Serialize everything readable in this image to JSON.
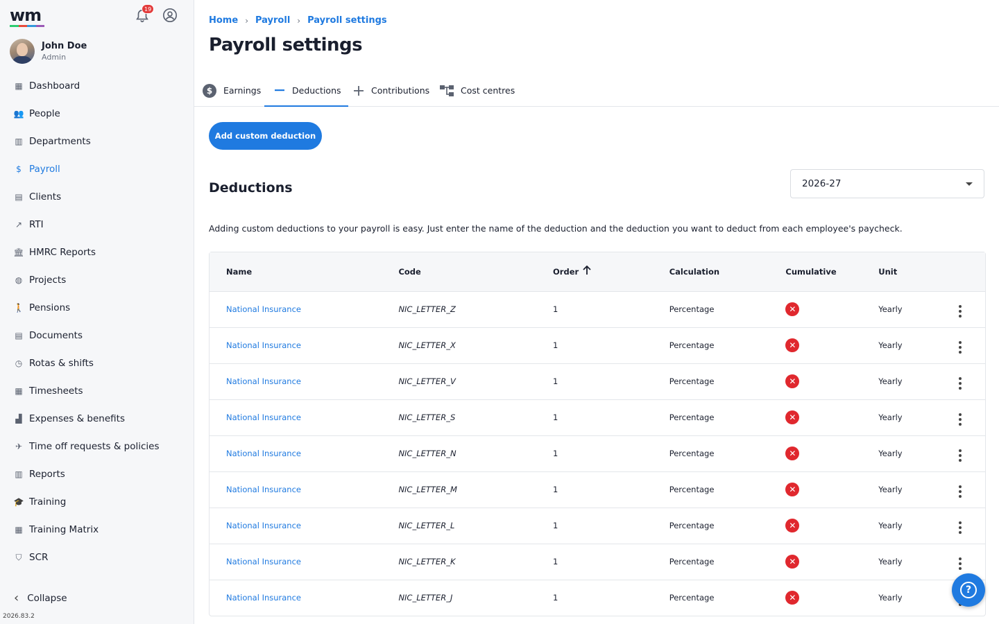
{
  "app": {
    "logo": "wm",
    "logo_colors": [
      "#2ecc71",
      "#e74c3c",
      "#3498db",
      "#9b59b6"
    ],
    "notifications_count": "19",
    "version": "2026.83.2"
  },
  "user": {
    "name": "John Doe",
    "role": "Admin"
  },
  "sidebar": {
    "items": [
      {
        "label": "Dashboard",
        "icon": "dashboard-icon",
        "glyph": "▦"
      },
      {
        "label": "People",
        "icon": "people-icon",
        "glyph": "👥"
      },
      {
        "label": "Departments",
        "icon": "building-icon",
        "glyph": "▥"
      },
      {
        "label": "Payroll",
        "icon": "dollar-icon",
        "glyph": "$"
      },
      {
        "label": "Clients",
        "icon": "clients-icon",
        "glyph": "▤"
      },
      {
        "label": "RTI",
        "icon": "trend-icon",
        "glyph": "↗"
      },
      {
        "label": "HMRC Reports",
        "icon": "bank-icon",
        "glyph": "🏛"
      },
      {
        "label": "Projects",
        "icon": "projects-icon",
        "glyph": "◍"
      },
      {
        "label": "Pensions",
        "icon": "pension-icon",
        "glyph": "🚶"
      },
      {
        "label": "Documents",
        "icon": "document-icon",
        "glyph": "▤"
      },
      {
        "label": "Rotas & shifts",
        "icon": "clock-icon",
        "glyph": "◷"
      },
      {
        "label": "Timesheets",
        "icon": "calendar-icon",
        "glyph": "▦"
      },
      {
        "label": "Expenses & benefits",
        "icon": "expenses-icon",
        "glyph": "▟"
      },
      {
        "label": "Time off requests & policies",
        "icon": "plane-icon",
        "glyph": "✈"
      },
      {
        "label": "Reports",
        "icon": "reports-icon",
        "glyph": "▥"
      },
      {
        "label": "Training",
        "icon": "graduation-icon",
        "glyph": "🎓"
      },
      {
        "label": "Training Matrix",
        "icon": "matrix-icon",
        "glyph": "▦"
      },
      {
        "label": "SCR",
        "icon": "shield-icon",
        "glyph": "⛉"
      }
    ],
    "active_index": 3,
    "collapse_label": "Collapse"
  },
  "breadcrumb": [
    "Home",
    "Payroll",
    "Payroll settings"
  ],
  "page_title": "Payroll settings",
  "tabs": [
    {
      "label": "Earnings",
      "icon": "dollar-circle-icon"
    },
    {
      "label": "Deductions",
      "icon": "minus-icon"
    },
    {
      "label": "Contributions",
      "icon": "plus-icon"
    },
    {
      "label": "Cost centres",
      "icon": "org-chart-icon"
    }
  ],
  "active_tab": 1,
  "add_button_label": "Add custom deduction",
  "section_title": "Deductions",
  "tax_year": "2026-27",
  "description": "Adding custom deductions to your payroll is easy. Just enter the name of the deduction and the deduction you want to deduct from each employee's paycheck.",
  "table": {
    "columns": [
      "Name",
      "Code",
      "Order",
      "Calculation",
      "Cumulative",
      "Unit"
    ],
    "rows": [
      {
        "name": "National Insurance",
        "code": "NIC_LETTER_Z",
        "order": "1",
        "calculation": "Percentage",
        "cumulative": false,
        "unit": "Yearly"
      },
      {
        "name": "National Insurance",
        "code": "NIC_LETTER_X",
        "order": "1",
        "calculation": "Percentage",
        "cumulative": false,
        "unit": "Yearly"
      },
      {
        "name": "National Insurance",
        "code": "NIC_LETTER_V",
        "order": "1",
        "calculation": "Percentage",
        "cumulative": false,
        "unit": "Yearly"
      },
      {
        "name": "National Insurance",
        "code": "NIC_LETTER_S",
        "order": "1",
        "calculation": "Percentage",
        "cumulative": false,
        "unit": "Yearly"
      },
      {
        "name": "National Insurance",
        "code": "NIC_LETTER_N",
        "order": "1",
        "calculation": "Percentage",
        "cumulative": false,
        "unit": "Yearly"
      },
      {
        "name": "National Insurance",
        "code": "NIC_LETTER_M",
        "order": "1",
        "calculation": "Percentage",
        "cumulative": false,
        "unit": "Yearly"
      },
      {
        "name": "National Insurance",
        "code": "NIC_LETTER_L",
        "order": "1",
        "calculation": "Percentage",
        "cumulative": false,
        "unit": "Yearly"
      },
      {
        "name": "National Insurance",
        "code": "NIC_LETTER_K",
        "order": "1",
        "calculation": "Percentage",
        "cumulative": false,
        "unit": "Yearly"
      },
      {
        "name": "National Insurance",
        "code": "NIC_LETTER_J",
        "order": "1",
        "calculation": "Percentage",
        "cumulative": false,
        "unit": "Yearly"
      }
    ]
  },
  "colors": {
    "accent": "#1f7ae0",
    "danger": "#e0282e"
  }
}
